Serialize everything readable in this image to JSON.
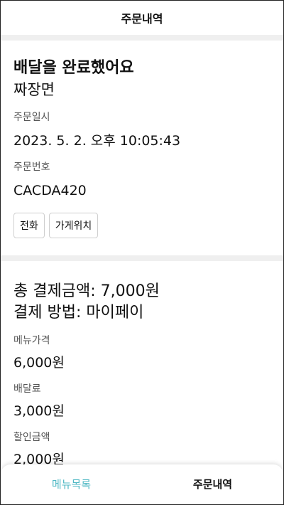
{
  "header": {
    "title": "주문내역"
  },
  "order": {
    "status": "배달을 완료했어요",
    "menu": "짜장면",
    "date_label": "주문일시",
    "date_value": "2023. 5. 2. 오후 10:05:43",
    "number_label": "주문번호",
    "number_value": "CACDA420",
    "call_button": "전화",
    "location_button": "가게위치"
  },
  "payment": {
    "total_line": "총 결제금액: 7,000원",
    "method_line": "결제 방법: 마이페이",
    "items": [
      {
        "label": "메뉴가격",
        "value": "6,000원"
      },
      {
        "label": "배달료",
        "value": "3,000원"
      },
      {
        "label": "할인금액",
        "value": "2,000원"
      }
    ]
  },
  "tabbar": {
    "tabs": [
      {
        "label": "메뉴목록",
        "active": false
      },
      {
        "label": "주문내역",
        "active": true
      }
    ]
  },
  "colors": {
    "accent": "#4fb8c4",
    "divider": "#efefef"
  }
}
